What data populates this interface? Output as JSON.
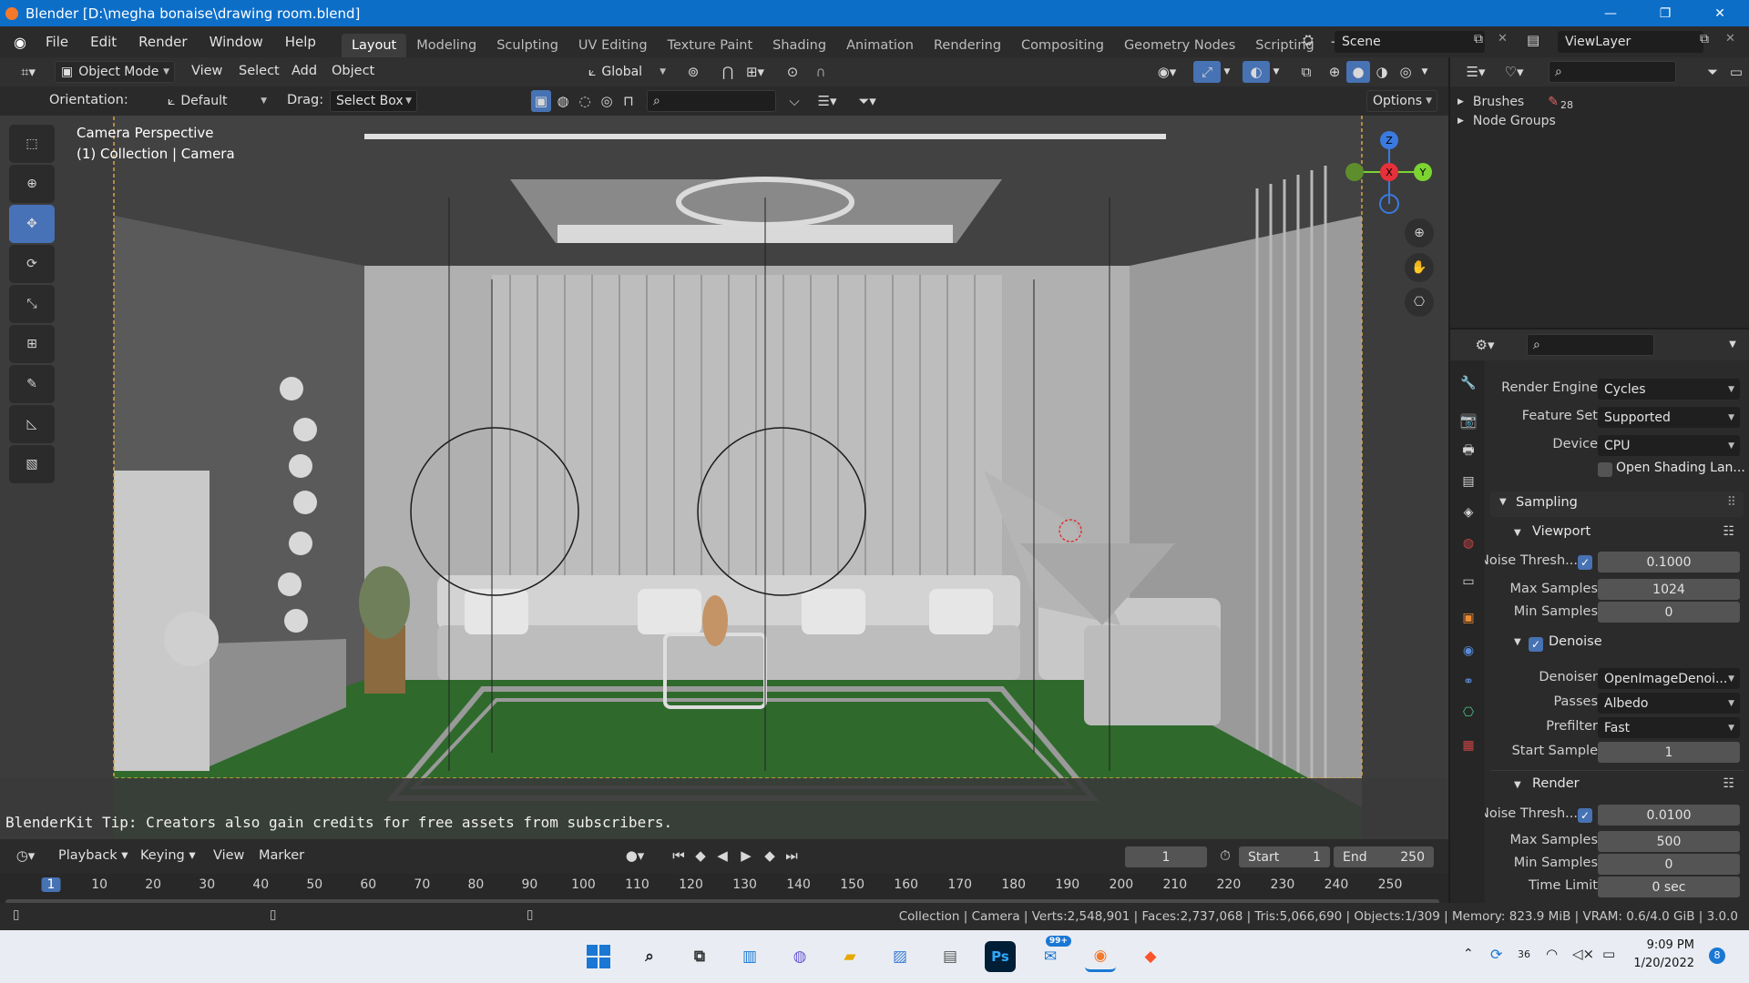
{
  "window": {
    "title": "Blender [D:\\megha bonaise\\drawing room.blend]",
    "minimize": "—",
    "maximize": "❐",
    "close": "✕"
  },
  "menu": [
    "File",
    "Edit",
    "Render",
    "Window",
    "Help"
  ],
  "workspaces": [
    {
      "label": "Layout",
      "active": true
    },
    {
      "label": "Modeling"
    },
    {
      "label": "Sculpting"
    },
    {
      "label": "UV Editing"
    },
    {
      "label": "Texture Paint"
    },
    {
      "label": "Shading"
    },
    {
      "label": "Animation"
    },
    {
      "label": "Rendering"
    },
    {
      "label": "Compositing"
    },
    {
      "label": "Geometry Nodes"
    },
    {
      "label": "Scripting"
    }
  ],
  "add_workspace": "+",
  "scene": {
    "label": "Scene",
    "view_layer": "ViewLayer"
  },
  "viewport_header": {
    "mode": "Object Mode",
    "menus": [
      "View",
      "Select",
      "Add",
      "Object"
    ],
    "transform_orientation": "Global"
  },
  "tool_header": {
    "orientation_label": "Orientation:",
    "orientation_value": "Default",
    "drag_label": "Drag:",
    "drag_value": "Select Box",
    "options": "Options"
  },
  "viewport": {
    "camera_label": "Camera Perspective",
    "collection_label": "(1) Collection | Camera",
    "tip": "BlenderKit Tip: Creators also gain credits for free assets from subscribers.",
    "gizmo": {
      "x": "X",
      "y": "Y",
      "z": "Z"
    }
  },
  "timeline": {
    "menus": [
      "Playback",
      "Keying",
      "View",
      "Marker"
    ],
    "current_frame": "1",
    "start_label": "Start",
    "start": "1",
    "end_label": "End",
    "end": "250",
    "ticks": [
      "1",
      "10",
      "20",
      "30",
      "40",
      "50",
      "60",
      "70",
      "80",
      "90",
      "100",
      "110",
      "120",
      "130",
      "140",
      "150",
      "160",
      "170",
      "180",
      "190",
      "200",
      "210",
      "220",
      "230",
      "240",
      "250"
    ]
  },
  "statusbar": {
    "stats": "Collection | Camera | Verts:2,548,901 | Faces:2,737,068 | Tris:5,066,690 | Objects:1/309 | Memory: 823.9 MiB | VRAM: 0.6/4.0 GiB | 3.0.0"
  },
  "outliner": {
    "items": [
      {
        "label": "Brushes",
        "badge": "28"
      },
      {
        "label": "Node Groups"
      }
    ]
  },
  "properties": {
    "render_engine_label": "Render Engine",
    "render_engine": "Cycles",
    "feature_set_label": "Feature Set",
    "feature_set": "Supported",
    "device_label": "Device",
    "device": "CPU",
    "osl_label": "Open Shading Lan...",
    "sampling": "Sampling",
    "viewport": {
      "title": "Viewport",
      "noise_label": "Noise Thresh...",
      "noise": "0.1000",
      "max_label": "Max Samples",
      "max": "1024",
      "min_label": "Min Samples",
      "min": "0"
    },
    "denoise": {
      "title": "Denoise",
      "denoiser_label": "Denoiser",
      "denoiser": "OpenImageDenoi...",
      "passes_label": "Passes",
      "passes": "Albedo",
      "prefilter_label": "Prefilter",
      "prefilter": "Fast",
      "start_label": "Start Sample",
      "start": "1"
    },
    "render": {
      "title": "Render",
      "noise_label": "Noise Thresh...",
      "noise": "0.0100",
      "max_label": "Max Samples",
      "max": "500",
      "min_label": "Min Samples",
      "min": "0",
      "time_label": "Time Limit",
      "time": "0 sec"
    }
  },
  "taskbar": {
    "time": "9:09 PM",
    "date": "1/20/2022",
    "mail_badge": "99+",
    "temp": "36",
    "notif": "8",
    "ps_label": "Ps"
  },
  "colors": {
    "accent": "#4772b3",
    "titlebar": "#0d6ec8",
    "floor": "#2f6a2c"
  }
}
